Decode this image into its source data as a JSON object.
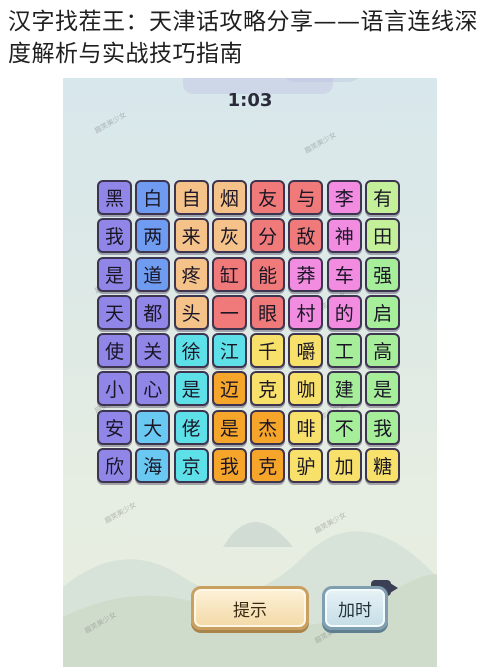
{
  "article": {
    "title": "汉字找茬王：天津话攻略分享——语言连线深度解析与实战技巧指南"
  },
  "game": {
    "timer": "1:03",
    "hint_button_label": "提示",
    "add_time_button_label": "加时",
    "watermark": "趣笑美少女",
    "grid": [
      [
        "黑",
        "白",
        "自",
        "烟",
        "友",
        "与",
        "李",
        "有"
      ],
      [
        "我",
        "两",
        "来",
        "灰",
        "分",
        "敌",
        "神",
        "田"
      ],
      [
        "是",
        "道",
        "疼",
        "缸",
        "能",
        "莽",
        "车",
        "强"
      ],
      [
        "天",
        "都",
        "头",
        "一",
        "眼",
        "村",
        "的",
        "启"
      ],
      [
        "使",
        "关",
        "徐",
        "江",
        "千",
        "嚼",
        "工",
        "高"
      ],
      [
        "小",
        "心",
        "是",
        "迈",
        "克",
        "咖",
        "建",
        "是"
      ],
      [
        "安",
        "大",
        "佬",
        "是",
        "杰",
        "啡",
        "不",
        "我"
      ],
      [
        "欣",
        "海",
        "京",
        "我",
        "克",
        "驴",
        "加",
        "糖"
      ]
    ],
    "column_colors": [
      "#8f86e8",
      "#6f9cf0",
      "#f5c38a",
      "#f58a8a",
      "#f07a7a",
      "#f18ce0",
      "#a6ee9a",
      "#c4f09a"
    ],
    "cell_colors": [
      [
        "#8f86e8",
        "#6f9cf0",
        "#f5c38a",
        "#f5c38a",
        "#f07a7a",
        "#f07a7a",
        "#f18ce0",
        "#c4f09a"
      ],
      [
        "#8f86e8",
        "#6f9cf0",
        "#f5c38a",
        "#f5c38a",
        "#f07a7a",
        "#f07a7a",
        "#f18ce0",
        "#c4f09a"
      ],
      [
        "#8f86e8",
        "#6f9cf0",
        "#f5c38a",
        "#f07a7a",
        "#f07a7a",
        "#f18ce0",
        "#f18ce0",
        "#a6ee9a"
      ],
      [
        "#8f86e8",
        "#8f86e8",
        "#f5c38a",
        "#f07a7a",
        "#f07a7a",
        "#f18ce0",
        "#f18ce0",
        "#a6ee9a"
      ],
      [
        "#8f86e8",
        "#8f86e8",
        "#5ee0e8",
        "#5ee0e8",
        "#f7e16a",
        "#f7e16a",
        "#a6ee9a",
        "#a6ee9a"
      ],
      [
        "#8f86e8",
        "#8f86e8",
        "#5ee0e8",
        "#f5a62a",
        "#f7e16a",
        "#f7e16a",
        "#a6ee9a",
        "#a6ee9a"
      ],
      [
        "#8f86e8",
        "#6ac9f2",
        "#5ee0e8",
        "#f5a62a",
        "#f5a62a",
        "#f7e16a",
        "#a6ee9a",
        "#a6ee9a"
      ],
      [
        "#8f86e8",
        "#6ac9f2",
        "#5ee0e8",
        "#f5a62a",
        "#f5a62a",
        "#f7e16a",
        "#f7e16a",
        "#f7e16a"
      ]
    ]
  }
}
